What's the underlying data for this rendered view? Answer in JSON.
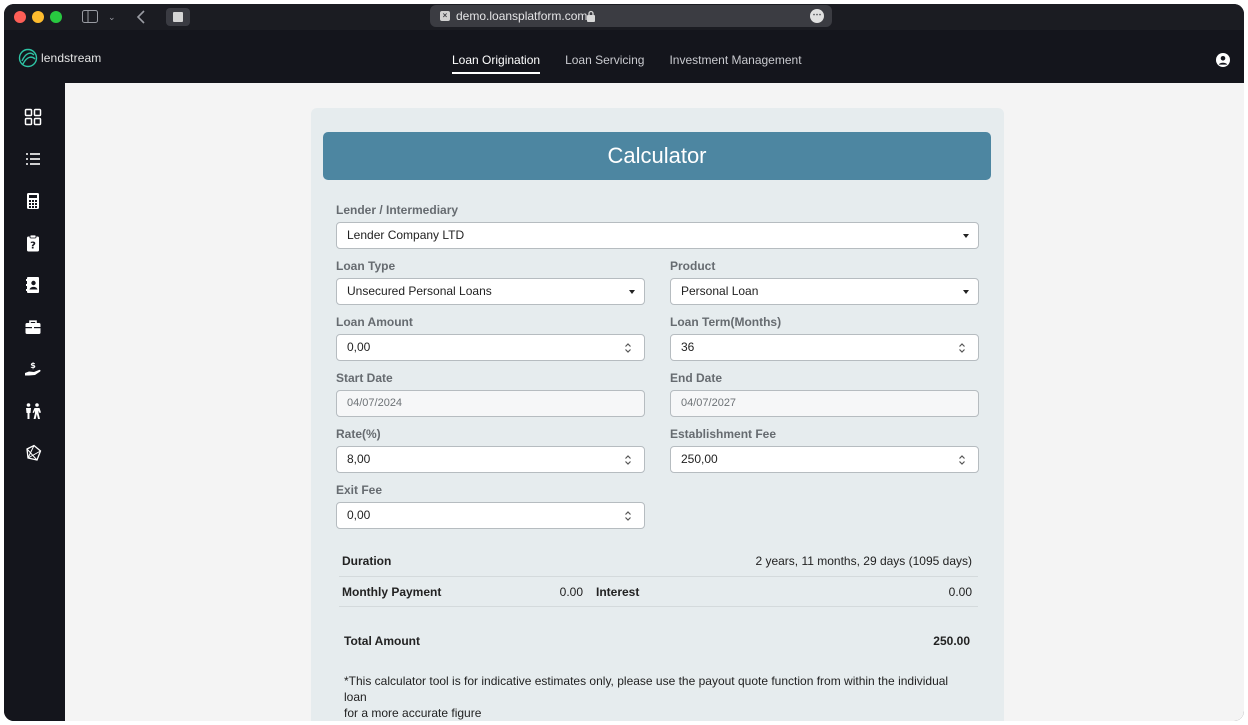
{
  "browser": {
    "url": "demo.loansplatform.com"
  },
  "app": {
    "logo_text": "lendstream",
    "nav": [
      {
        "label": "Loan Origination",
        "active": true
      },
      {
        "label": "Loan Servicing",
        "active": false
      },
      {
        "label": "Investment Management",
        "active": false
      }
    ],
    "sidebar_icons": [
      "dashboard-grid-icon",
      "list-icon",
      "calculator-icon",
      "clipboard-question-icon",
      "contact-book-icon",
      "briefcase-icon",
      "hand-dollar-icon",
      "people-icon",
      "network-icon"
    ],
    "accent_color": "#4d86a1"
  },
  "calculator": {
    "title": "Calculator",
    "lender": {
      "label": "Lender / Intermediary",
      "value": "Lender Company LTD"
    },
    "loan_type": {
      "label": "Loan Type",
      "value": "Unsecured Personal Loans"
    },
    "product": {
      "label": "Product",
      "value": "Personal Loan"
    },
    "loan_amount": {
      "label": "Loan Amount",
      "value": "0,00"
    },
    "loan_term": {
      "label": "Loan Term(Months)",
      "value": "36"
    },
    "start_date": {
      "label": "Start Date",
      "value": "04/07/2024"
    },
    "end_date": {
      "label": "End Date",
      "value": "04/07/2027"
    },
    "rate": {
      "label": "Rate(%)",
      "value": "8,00"
    },
    "establishment_fee": {
      "label": "Establishment Fee",
      "value": "250,00"
    },
    "exit_fee": {
      "label": "Exit Fee",
      "value": "0,00"
    },
    "results": {
      "duration_label": "Duration",
      "duration_value": "2 years, 11 months, 29 days (1095 days)",
      "monthly_payment_label": "Monthly Payment",
      "monthly_payment_value": "0.00",
      "interest_label": "Interest",
      "interest_value": "0.00",
      "total_label": "Total Amount",
      "total_value": "250.00"
    },
    "note_line1": "*This calculator tool is for indicative estimates only, please use the payout quote function from within the individual loan",
    "note_line2": "for a more accurate figure"
  }
}
